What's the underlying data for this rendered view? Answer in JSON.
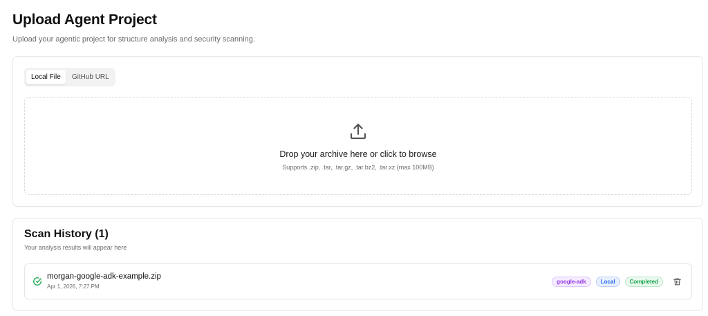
{
  "header": {
    "title": "Upload Agent Project",
    "subtitle": "Upload your agentic project for structure analysis and security scanning."
  },
  "upload": {
    "tabs": [
      {
        "label": "Local File",
        "active": true
      },
      {
        "label": "GitHub URL",
        "active": false
      }
    ],
    "dropzone": {
      "icon": "upload-icon",
      "title": "Drop your archive here or click to browse",
      "hint": "Supports .zip, .tar, .tar.gz, .tar.bz2, .tar.xz (max 100MB)"
    }
  },
  "history": {
    "title": "Scan History (1)",
    "subtitle": "Your analysis results will appear here",
    "items": [
      {
        "status_icon": "check-circle-icon",
        "file_name": "morgan-google-adk-example.zip",
        "date": "Apr 1, 2026, 7:27 PM",
        "badges": {
          "framework": "google-adk",
          "source": "Local",
          "status": "Completed"
        },
        "action_icon": "trash-icon"
      }
    ]
  },
  "colors": {
    "success": "#16a34a",
    "framework_badge": "#9333ea",
    "source_badge": "#2563eb"
  }
}
